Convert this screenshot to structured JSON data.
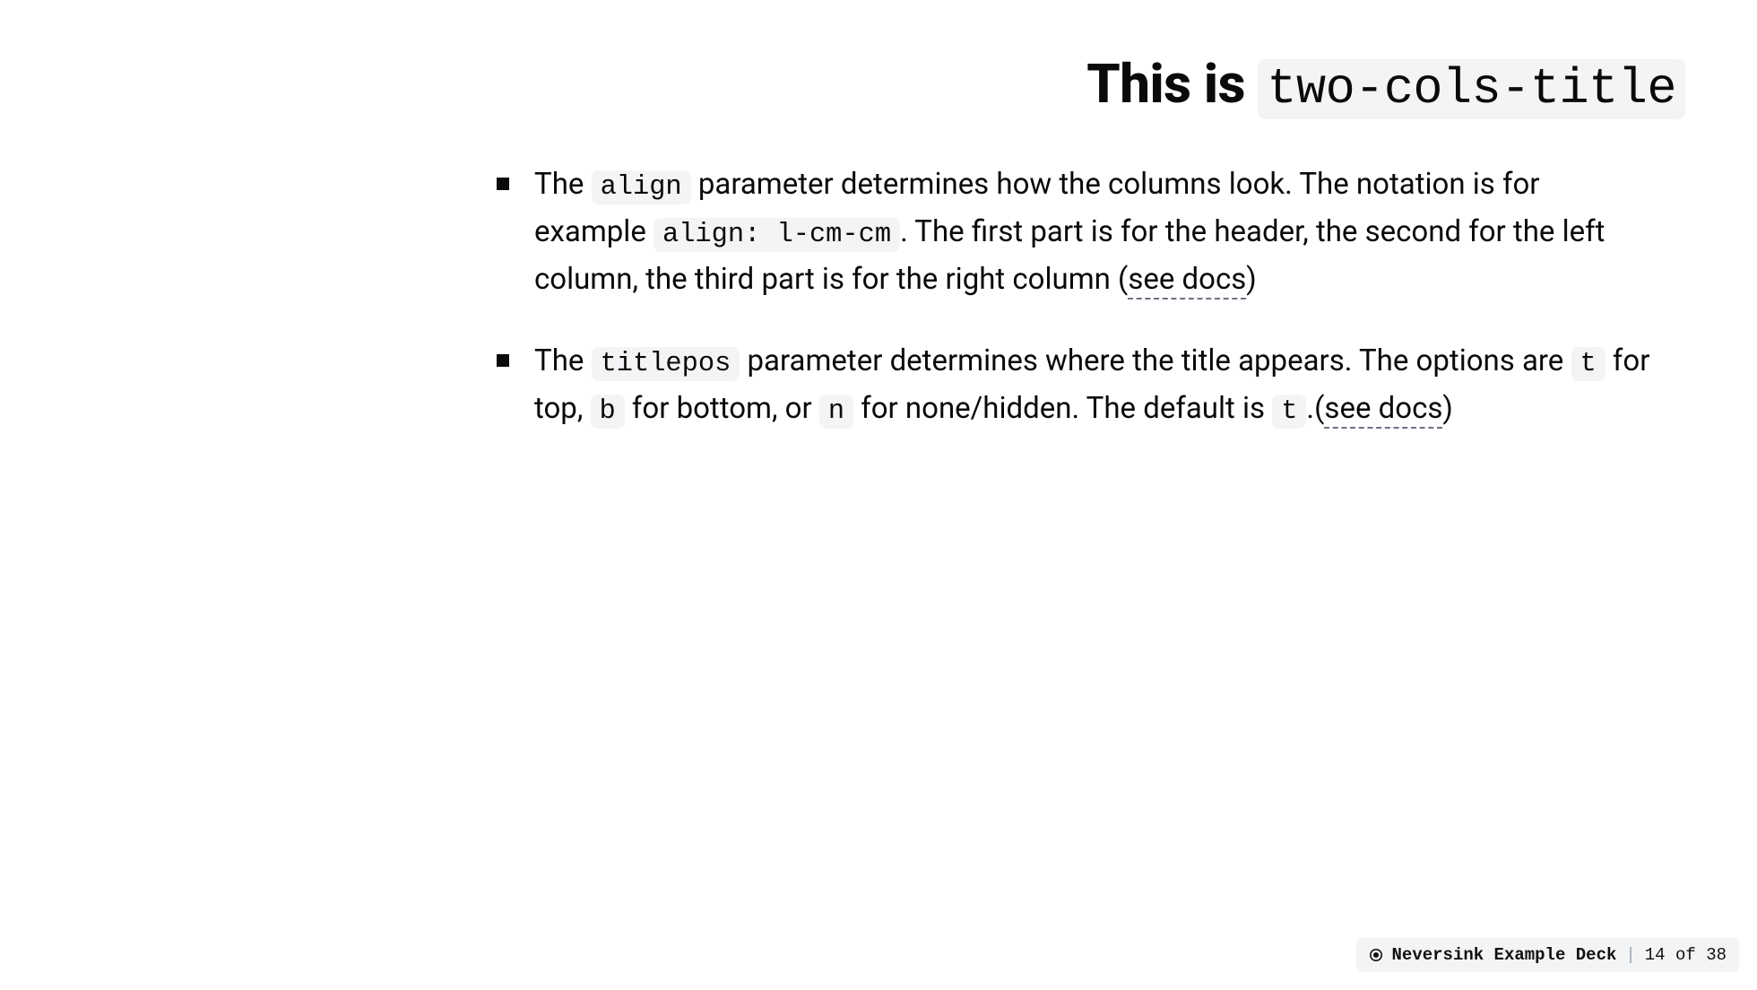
{
  "title": {
    "prefix": "This is ",
    "code": "two-cols-title"
  },
  "bullets": [
    {
      "seg1a": "The ",
      "code1": "align",
      "seg1b": " parameter determines how the columns look. The notation is for example ",
      "code2": "align: l-cm-cm",
      "seg1c": ". The first part is for the header, the second for the left column, the third part is for the right column (",
      "link": "see docs",
      "seg1d": ")"
    },
    {
      "seg2a": "The ",
      "code1": "titlepos",
      "seg2b": " parameter determines where the title appears. The options are ",
      "code2": "t",
      "seg2c": " for top, ",
      "code3": "b",
      "seg2d": " for bottom, or ",
      "code4": "n",
      "seg2e": " for none/hidden. The default is ",
      "code5": "t",
      "seg2f": ".(",
      "link": "see docs",
      "seg2g": ")"
    }
  ],
  "footer": {
    "deck": "Neversink Example Deck",
    "sep": "|",
    "page": "14 of 38"
  }
}
